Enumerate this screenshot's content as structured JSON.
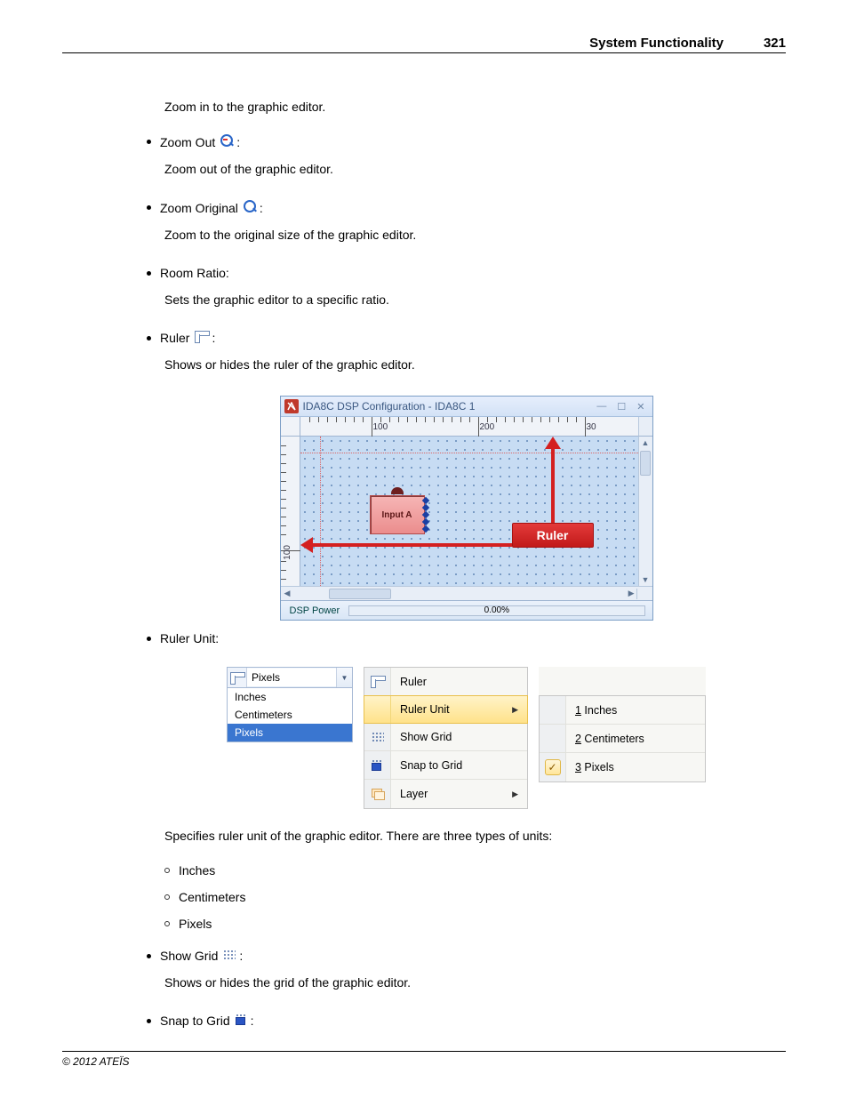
{
  "header": {
    "title": "System Functionality",
    "page": "321"
  },
  "items": {
    "zoom_in_desc": "Zoom in to the graphic editor.",
    "zoom_out": {
      "label": "Zoom Out",
      "desc": "Zoom out of the graphic editor."
    },
    "zoom_orig": {
      "label": "Zoom Original",
      "desc": "Zoom to the original size of the graphic editor."
    },
    "room_ratio": {
      "label": "Room Ratio:",
      "desc": "Sets the graphic editor to a specific ratio."
    },
    "ruler": {
      "label": "Ruler",
      "desc": "Shows or hides the ruler of the graphic editor."
    },
    "ruler_unit": {
      "label": "Ruler Unit:",
      "desc": "Specifies ruler unit of the graphic editor. There are three types of units:",
      "sub": [
        "Inches",
        "Centimeters",
        "Pixels"
      ]
    },
    "show_grid": {
      "label": "Show Grid",
      "desc": "Shows or hides the grid of the graphic editor."
    },
    "snap_grid": {
      "label": "Snap to Grid"
    }
  },
  "dsp": {
    "title": "IDA8C DSP Configuration - IDA8C 1",
    "ruler_ticks_h": [
      "100",
      "200",
      "30"
    ],
    "ruler_ticks_v": [
      "100"
    ],
    "node_label": "Input A",
    "callout": "Ruler",
    "status_label": "DSP Power",
    "status_value": "0.00%"
  },
  "dropdown": {
    "selected": "Pixels",
    "options": [
      "Inches",
      "Centimeters",
      "Pixels"
    ]
  },
  "menu": {
    "items": [
      {
        "label": "Ruler",
        "has_sub": false
      },
      {
        "label": "Ruler Unit",
        "has_sub": true,
        "hl": true
      },
      {
        "label": "Show Grid",
        "has_sub": false
      },
      {
        "label": "Snap to Grid",
        "has_sub": false
      },
      {
        "label": "Layer",
        "has_sub": true
      }
    ],
    "sub": [
      {
        "u": "1",
        "label": " Inches",
        "checked": false
      },
      {
        "u": "2",
        "label": " Centimeters",
        "checked": false
      },
      {
        "u": "3",
        "label": " Pixels",
        "checked": true
      }
    ]
  },
  "footer": "© 2012 ATEÏS"
}
